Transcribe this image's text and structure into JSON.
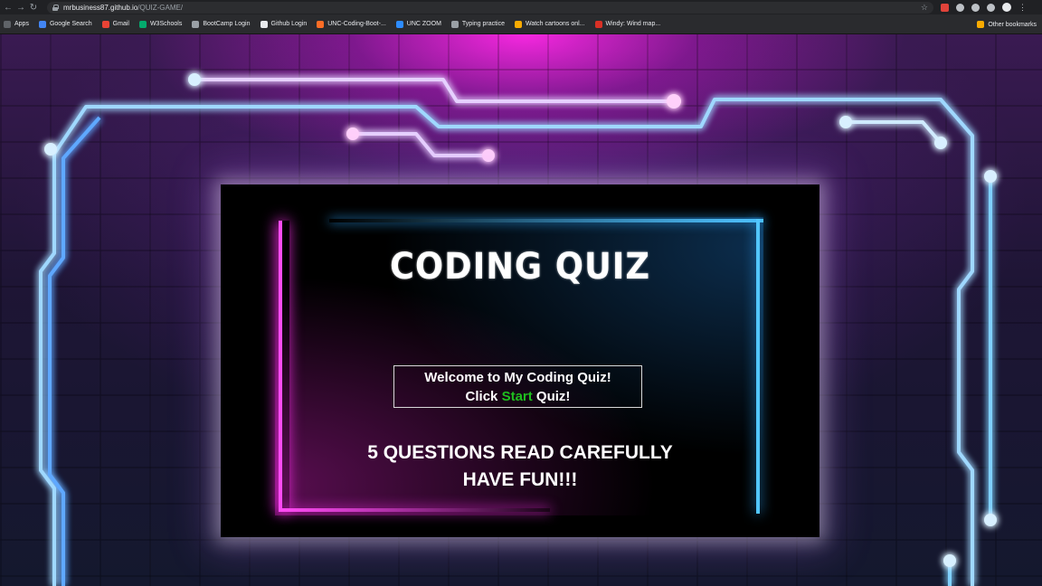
{
  "browser": {
    "url_host": "mrbusiness87.github.io",
    "url_path": "/QUIZ-GAME/",
    "bookmarks": [
      {
        "label": "Apps",
        "color": "#5f6368"
      },
      {
        "label": "Google Search",
        "color": "#4285f4"
      },
      {
        "label": "Gmail",
        "color": "#ea4335"
      },
      {
        "label": "W3Schools",
        "color": "#04aa6d"
      },
      {
        "label": "BootCamp Login",
        "color": "#9aa0a6"
      },
      {
        "label": "Github Login",
        "color": "#e8eaed"
      },
      {
        "label": "UNC-Coding-Boot-...",
        "color": "#fc6d26"
      },
      {
        "label": "UNC ZOOM",
        "color": "#2d8cff"
      },
      {
        "label": "Typing practice",
        "color": "#9aa0a6"
      },
      {
        "label": "Watch cartoons onl...",
        "color": "#f9ab00"
      },
      {
        "label": "Windy: Wind map...",
        "color": "#d93025"
      }
    ],
    "other_bookmarks": "Other bookmarks"
  },
  "quiz": {
    "title": "CODING QUIZ",
    "welcome_line": "Welcome to My Coding Quiz!",
    "click_prefix": "Click ",
    "start_word": "Start",
    "click_suffix": " Quiz!",
    "info_line1": "5 QUESTIONS READ CAREFULLY",
    "info_line2": "HAVE FUN!!!"
  },
  "colors": {
    "start_accent": "#1fbf1f",
    "neon_pink": "#ff4cf5",
    "neon_blue": "#52c6ff"
  }
}
